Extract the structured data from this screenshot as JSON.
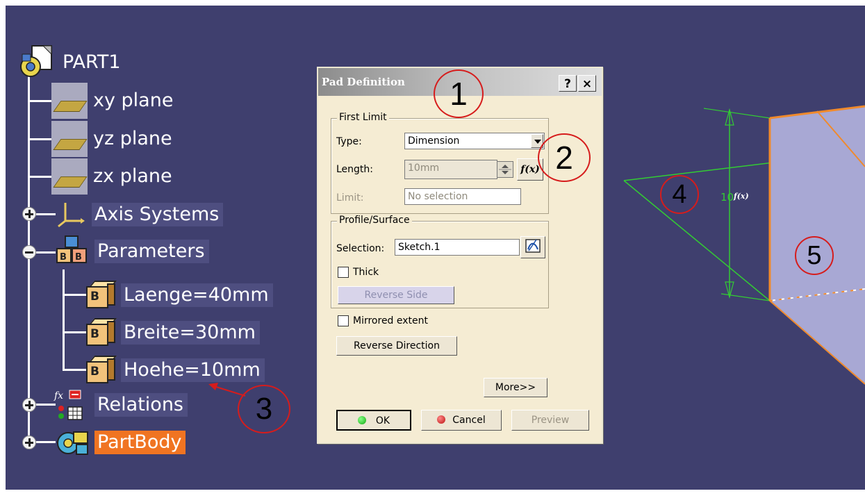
{
  "colors": {
    "viewport_bg": "#3f3f6e",
    "highlight_bg": "#4e4e80",
    "selected_bg": "#f07422",
    "annotation_circle": "#d61c1c",
    "dimension_green": "#33cc33",
    "solid_face": "#a8a8d4",
    "solid_edge": "#f08a2c"
  },
  "tree": {
    "root": {
      "label": "PART1",
      "icon": "part-document-icon"
    },
    "planes": [
      {
        "label": "xy plane",
        "icon": "plane-icon"
      },
      {
        "label": "yz plane",
        "icon": "plane-icon"
      },
      {
        "label": "zx plane",
        "icon": "plane-icon"
      }
    ],
    "axis_systems": {
      "label": "Axis Systems",
      "icon": "axis-system-icon",
      "expander": "plus"
    },
    "parameters": {
      "label": "Parameters",
      "icon": "parameters-icon",
      "expander": "minus",
      "items": [
        {
          "label": "Laenge=40mm",
          "icon": "length-parameter-icon"
        },
        {
          "label": "Breite=30mm",
          "icon": "length-parameter-icon"
        },
        {
          "label": "Hoehe=10mm",
          "icon": "length-parameter-icon"
        }
      ]
    },
    "relations": {
      "label": "Relations",
      "icon": "relations-icon",
      "expander": "plus"
    },
    "part_body": {
      "label": "PartBody",
      "icon": "part-body-icon",
      "expander": "plus"
    }
  },
  "dialog": {
    "title": "Pad Definition",
    "help_label": "?",
    "close_label": "×",
    "first_limit": {
      "group_label": "First Limit",
      "type_label": "Type:",
      "type_value": "Dimension",
      "length_label": "Length:",
      "length_value": "10mm",
      "formula_label": "f(x)",
      "limit_label": "Limit:",
      "limit_value": "No selection"
    },
    "profile": {
      "group_label": "Profile/Surface",
      "selection_label": "Selection:",
      "selection_value": "Sketch.1",
      "thick_label": "Thick",
      "reverse_side_label": "Reverse Side"
    },
    "mirrored_label": "Mirrored extent",
    "reverse_direction_label": "Reverse Direction",
    "more_label": "More>>",
    "ok_label": "OK",
    "cancel_label": "Cancel",
    "preview_label": "Preview"
  },
  "viewport": {
    "dimension_value": "10",
    "formula_marker": "f(x)"
  },
  "annotations": [
    "1",
    "2",
    "3",
    "4",
    "5"
  ]
}
